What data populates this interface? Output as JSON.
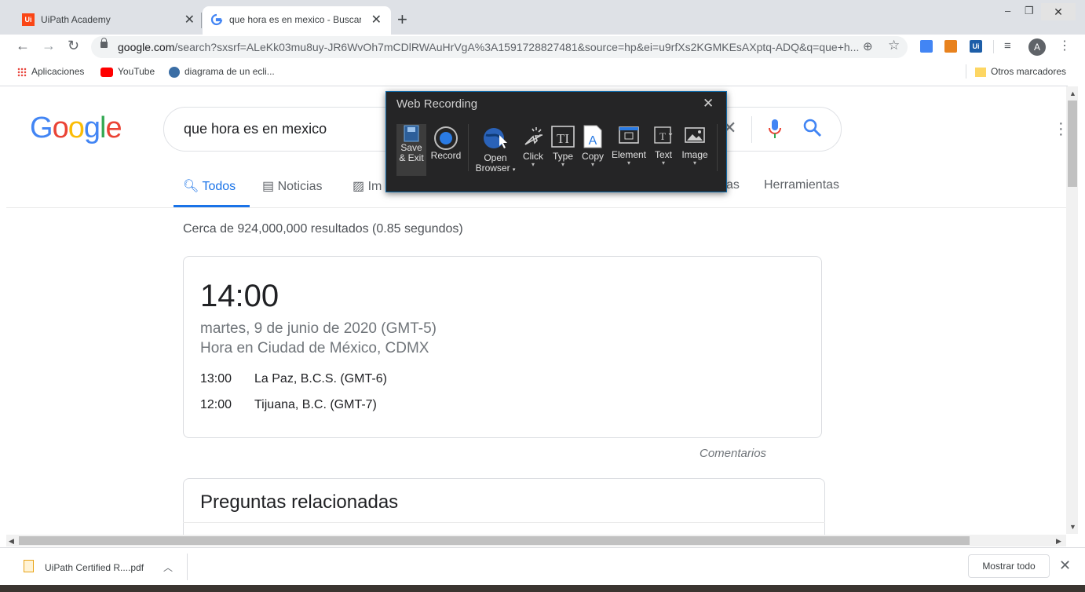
{
  "browser": {
    "tabs": [
      {
        "title": "UiPath Academy",
        "active": false
      },
      {
        "title": "que hora es en mexico - Buscar c",
        "active": true
      }
    ],
    "url_host": "google.com",
    "url_rest": "/search?sxsrf=ALeKk03mu8uy-JR6WvOh7mCDlRWAuHrVgA%3A1591728827481&source=hp&ei=u9rfXs2KGMKEsAXptq-ADQ&q=que+h...",
    "avatar_letter": "A",
    "bookmarks": [
      "Aplicaciones",
      "YouTube",
      "diagrama de un ecli..."
    ],
    "other_bookmarks": "Otros marcadores"
  },
  "google": {
    "logo": "Google",
    "query": "que hora es en mexico",
    "tabs": [
      "Todos",
      "Noticias",
      "Im",
      "as",
      "Herramientas"
    ],
    "stats": "Cerca de 924,000,000 resultados (0.85 segundos)",
    "time_card": {
      "time": "14:00",
      "date": "martes, 9 de junio de 2020 (GMT-5)",
      "place": "Hora en Ciudad de México, CDMX",
      "others": [
        {
          "time": "13:00",
          "city": "La Paz, B.C.S. (GMT-6)"
        },
        {
          "time": "12:00",
          "city": "Tijuana, B.C. (GMT-7)"
        }
      ]
    },
    "feedback": "Comentarios",
    "related_title": "Preguntas relacionadas"
  },
  "downloads": {
    "file": "UiPath Certified R....pdf",
    "show_all": "Mostrar todo"
  },
  "recorder": {
    "title": "Web Recording",
    "buttons": [
      {
        "l1": "Save",
        "l2": "& Exit"
      },
      {
        "l1": "Record",
        "l2": ""
      },
      {
        "l1": "Open",
        "l2": "Browser"
      },
      {
        "l1": "Click",
        "l2": ""
      },
      {
        "l1": "Type",
        "l2": ""
      },
      {
        "l1": "Copy",
        "l2": ""
      },
      {
        "l1": "Element",
        "l2": ""
      },
      {
        "l1": "Text",
        "l2": ""
      },
      {
        "l1": "Image",
        "l2": ""
      }
    ]
  },
  "colors": {
    "accent": "#1a73e8",
    "recorder_bg": "#252526",
    "recorder_border": "#0f6aa8"
  }
}
